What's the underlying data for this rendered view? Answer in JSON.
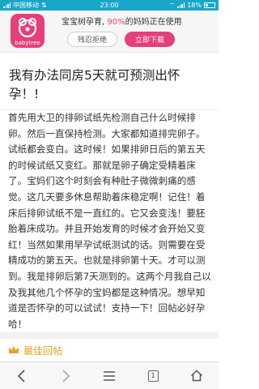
{
  "status_bar": {
    "carrier": "中国移动",
    "time": "23:00",
    "battery": "18%"
  },
  "app_banner": {
    "logo_text": "babytree",
    "promo_prefix": "宝宝树孕育, ",
    "promo_percent": "90%",
    "promo_suffix": "的妈妈正在使用",
    "reject_label": "残忍拒绝",
    "download_label": "立即下载"
  },
  "post": {
    "title": "我有办法同房5天就可预测出怀孕！!",
    "body": "首先用大卫的排卵试纸先检测自己什么时候排卵。然后一直保持检测。大家都知道排完卵子。试纸都会变白。这时候！如果排卵日后的第五天的时候试纸又变红。那就是卵子确定受精着床了。宝妈们这个时刻会有种肚子微微刺痛的感觉。这几天要多休息帮助着床稳定啊！记住！着床后排卵试纸不是一直红的。它又会变浅！要胚胎着床成功。并且开始发育的时候才会开始又变红！当然如果用早孕试纸测试的话。则需要在受精成功的第五天。也就是排卵第十天。才可以测到。我是排卵后第7天测到的。这两个月我自己以及我其他几个怀孕的宝妈都是这种情况。想早知道是否怀孕的可以试试！支持一下！回帖必好孕哈！"
  },
  "best_replies": {
    "label": "最佳回帖",
    "icon": "crown-icon"
  },
  "bottom_nav": {
    "tab_count": "1"
  },
  "colors": {
    "status_bar": "#1aa6c9",
    "brand_pink": "#e5407a",
    "best_reply": "#e8a020"
  }
}
